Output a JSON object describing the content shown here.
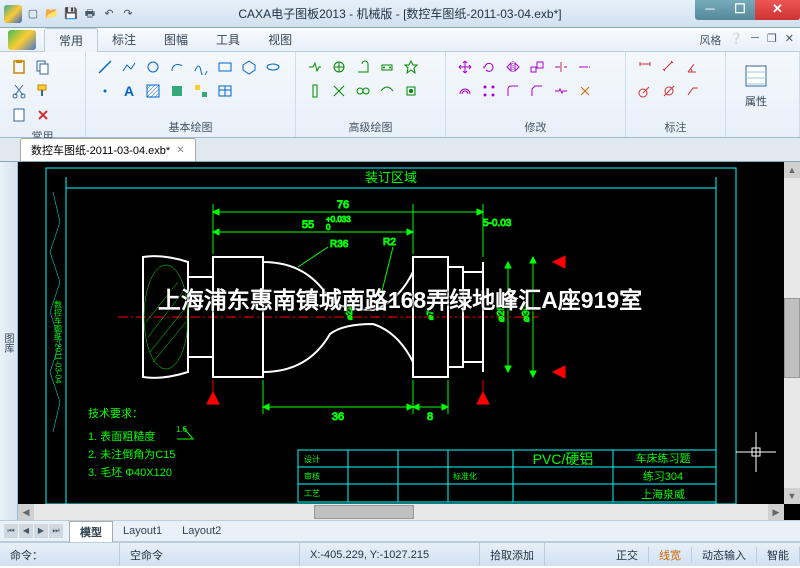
{
  "titlebar": {
    "title": "CAXA电子图板2013 - 机械版 - [数控车图纸-2011-03-04.exb*]"
  },
  "menu": {
    "tabs": [
      "常用",
      "标注",
      "图幅",
      "工具",
      "视图"
    ],
    "style_label": "风格"
  },
  "ribbon": {
    "groups": {
      "g1": "常用",
      "g2": "基本绘图",
      "g3": "高级绘图",
      "g4": "修改",
      "g5": "标注"
    },
    "props_label": "属性"
  },
  "doc_tab": {
    "name": "数控车图纸-2011-03-04.exb*"
  },
  "vtoolbar": {
    "label": "图库"
  },
  "cad": {
    "binding_area": "装订区域",
    "dims": {
      "d76": "76",
      "d55": "55",
      "d36": "36",
      "d8": "8",
      "tol": "+0.033",
      "tol2": "0",
      "r36": "R36",
      "r2": "R2",
      "tol3": "5-0.03",
      "tol4": "0"
    },
    "notes": {
      "title": "技术要求：",
      "n1": "1. 表面粗糙度",
      "n2": "2. 未注倒角为C15",
      "n3": "3. 毛坯 Φ40X120",
      "rough": "1.6"
    },
    "titleblock": {
      "mat": "PVC/硬铝",
      "desc": "车床练习题",
      "name": "练习304",
      "co": "上海泉威",
      "std": "标准化",
      "proc": "工艺",
      "design": "设计",
      "check": "审核"
    }
  },
  "watermark": "上海浦东惠南镇城南路168弄绿地峰汇A座919室",
  "layouts": {
    "model": "模型",
    "l1": "Layout1",
    "l2": "Layout2"
  },
  "status": {
    "cmd": "命令：",
    "empty": "空命令",
    "coords": "X:-405.229, Y:-1027.215",
    "pick": "拾取添加",
    "ortho": "正交",
    "lw": "线宽",
    "dyn": "动态输入",
    "snap": "智能"
  }
}
